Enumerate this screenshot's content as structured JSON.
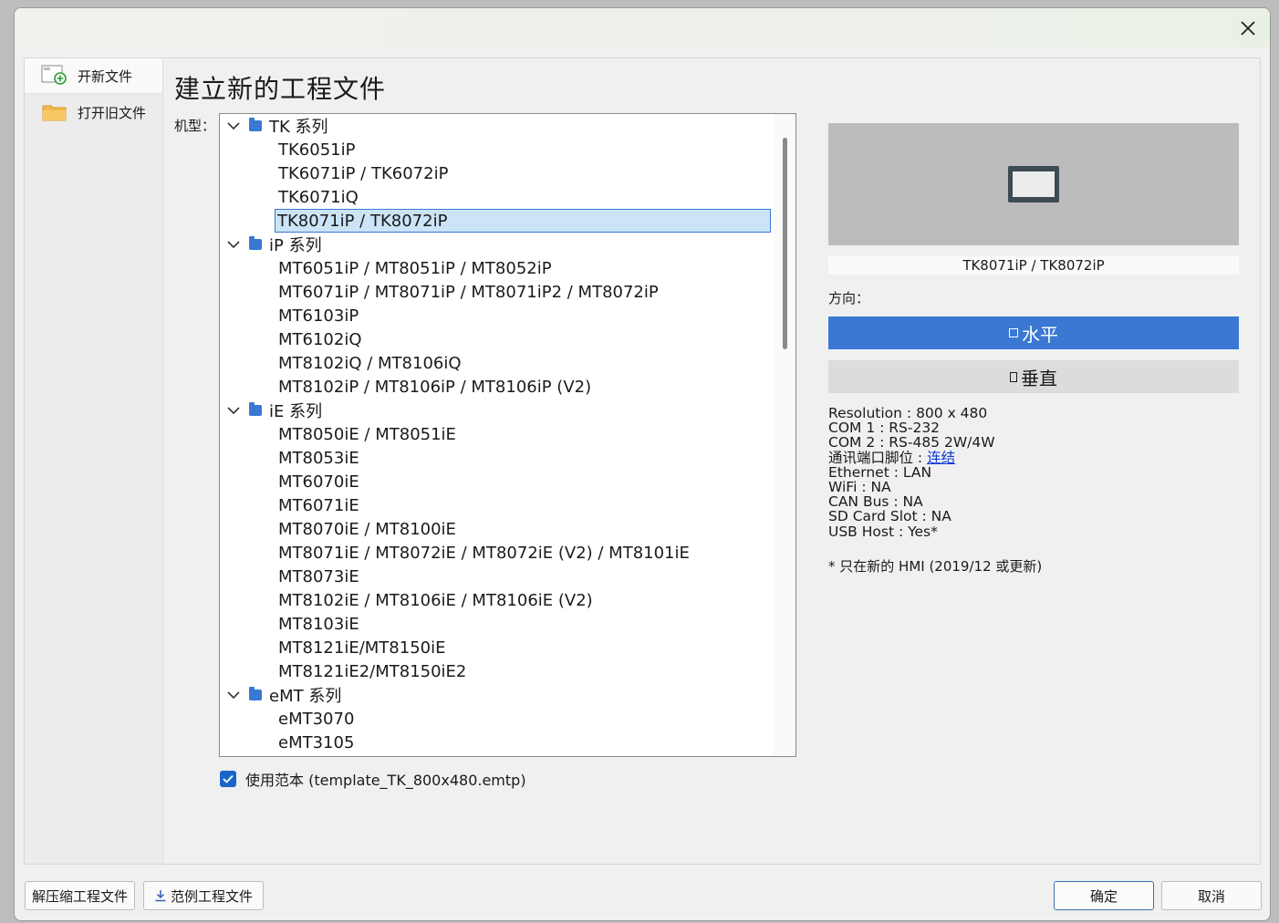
{
  "dialog": {
    "close_label": "close"
  },
  "sidebar": {
    "items": [
      {
        "label": "开新文件",
        "icon": "new-file-icon",
        "active": true
      },
      {
        "label": "打开旧文件",
        "icon": "folder-icon",
        "active": false
      }
    ]
  },
  "main": {
    "title": "建立新的工程文件",
    "model_label": "机型：",
    "tree": {
      "groups": [
        {
          "label": "TK 系列",
          "items": [
            "TK6051iP",
            "TK6071iP / TK6072iP",
            "TK6071iQ",
            "TK8071iP / TK8072iP"
          ]
        },
        {
          "label": "iP 系列",
          "items": [
            "MT6051iP / MT8051iP / MT8052iP",
            "MT6071iP / MT8071iP / MT8071iP2 / MT8072iP",
            "MT6103iP",
            "MT6102iQ",
            "MT8102iQ / MT8106iQ",
            "MT8102iP / MT8106iP / MT8106iP (V2)"
          ]
        },
        {
          "label": "iE 系列",
          "items": [
            "MT8050iE / MT8051iE",
            "MT8053iE",
            "MT6070iE",
            "MT6071iE",
            "MT8070iE / MT8100iE",
            "MT8071iE / MT8072iE / MT8072iE (V2) / MT8101iE",
            "MT8073iE",
            "MT8102iE / MT8106iE / MT8106iE (V2)",
            "MT8103iE",
            "MT8121iE/MT8150iE",
            "MT8121iE2/MT8150iE2"
          ]
        },
        {
          "label": "eMT 系列",
          "items": [
            "eMT3070",
            "eMT3105"
          ]
        }
      ],
      "selected": "TK8071iP / TK8072iP"
    },
    "template_checkbox": {
      "checked": true,
      "label": "使用范本 (template_TK_800x480.emtp)"
    }
  },
  "preview": {
    "caption": "TK8071iP / TK8072iP",
    "orientation_label": "方向：",
    "horizontal_label": "水平",
    "vertical_label": "垂直",
    "selected_orientation": "水平"
  },
  "specs": {
    "resolution": "Resolution : 800 x 480",
    "com1": "COM 1 : RS-232",
    "com2": "COM 2 : RS-485 2W/4W",
    "pin_prefix": "通讯端口脚位 : ",
    "pin_link": "连结",
    "ethernet": "Ethernet : LAN",
    "wifi": "WiFi : NA",
    "canbus": "CAN Bus : NA",
    "sd": "SD Card Slot : NA",
    "usb": "USB Host : Yes*",
    "note": "* 只在新的 HMI (2019/12 或更新)"
  },
  "footer": {
    "decompress_label": "解压缩工程文件",
    "sample_label": "范例工程文件",
    "ok_label": "确定",
    "cancel_label": "取消"
  },
  "colors": {
    "accent": "#3a78d3",
    "selection_bg": "#cce4f7",
    "link": "#0b3bd1"
  }
}
